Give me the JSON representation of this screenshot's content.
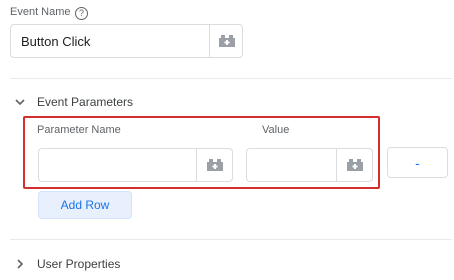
{
  "event_name": {
    "label": "Event Name",
    "value": "Button Click"
  },
  "event_parameters": {
    "title": "Event Parameters",
    "parameter_name_header": "Parameter Name",
    "value_header": "Value",
    "rows": [
      {
        "parameter_name": "",
        "value": "",
        "remove_label": "-"
      }
    ],
    "add_row_label": "Add Row"
  },
  "user_properties": {
    "title": "User Properties"
  },
  "colors": {
    "highlight": "#d32f2f",
    "accent": "#1a73e8",
    "add_row_bg": "#e8f0fe"
  },
  "icons": [
    "help-icon",
    "variable-picker-icon",
    "chevron-down-icon",
    "chevron-right-icon"
  ]
}
